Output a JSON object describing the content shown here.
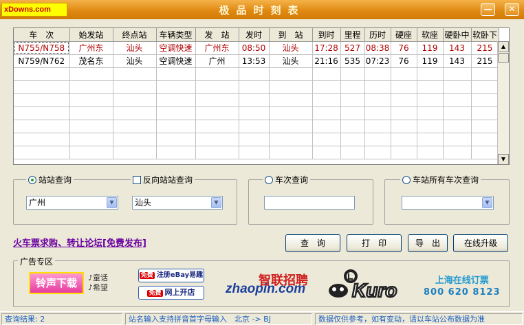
{
  "window": {
    "logo": "xDowns.com",
    "title": "极品时刻表",
    "minimize_label": "—",
    "close_label": "✕"
  },
  "table": {
    "columns": [
      "车　次",
      "始发站",
      "终点站",
      "车辆类型",
      "发　站",
      "发时",
      "到　站",
      "到时",
      "里程",
      "历时",
      "硬座",
      "软座",
      "硬卧中",
      "软卧下"
    ],
    "rows": [
      [
        "N755/N758",
        "广州东",
        "汕头",
        "空调快速",
        "广州东",
        "08:50",
        "汕头",
        "17:28",
        "527",
        "08:38",
        "76",
        "119",
        "143",
        "215"
      ],
      [
        "N759/N762",
        "茂名东",
        "汕头",
        "空调快速",
        "广州",
        "13:53",
        "汕头",
        "21:16",
        "535",
        "07:23",
        "76",
        "119",
        "143",
        "215"
      ]
    ],
    "selected_row": 0
  },
  "station_query": {
    "label": "站站查询",
    "checked": true,
    "from_value": "广州",
    "reverse_label": "反向站站查询",
    "reverse_checked": false,
    "to_value": "汕头"
  },
  "train_query": {
    "label": "车次查询",
    "value": ""
  },
  "all_trains_query": {
    "label": "车站所有车次查询",
    "value": ""
  },
  "forum_link": "火车票求购、转让论坛[免费发布]",
  "buttons": {
    "query": "查　询",
    "print": "打　印",
    "export": "导　出",
    "upgrade": "在线升级"
  },
  "ads": {
    "label": "广告专区",
    "ringtone": "铃声下载",
    "ringtone_note1": "♪童话",
    "ringtone_note2": "♪希望",
    "ebay_badge": "免费",
    "ebay": "注册eBay易趣",
    "shop_badge": "免费",
    "shop": "网上开店",
    "zhaopin_cn": "智联招聘",
    "zhaopin_en": "zhaopin.com",
    "kuro": "Kuro",
    "booking_title": "上海在线订票",
    "booking_phone": "800 620 8123"
  },
  "status": {
    "result": "查询结果: 2",
    "hint": "站名输入支持拼音首字母输入　北京 -> BJ",
    "disclaimer": "数据仅供参考，如有变动，请以车站公布数据为准"
  },
  "colors": {
    "title_bar": "#e08a12",
    "selected_text": "#b00000",
    "link": "#6a00a0",
    "status_text": "#2060c0"
  }
}
